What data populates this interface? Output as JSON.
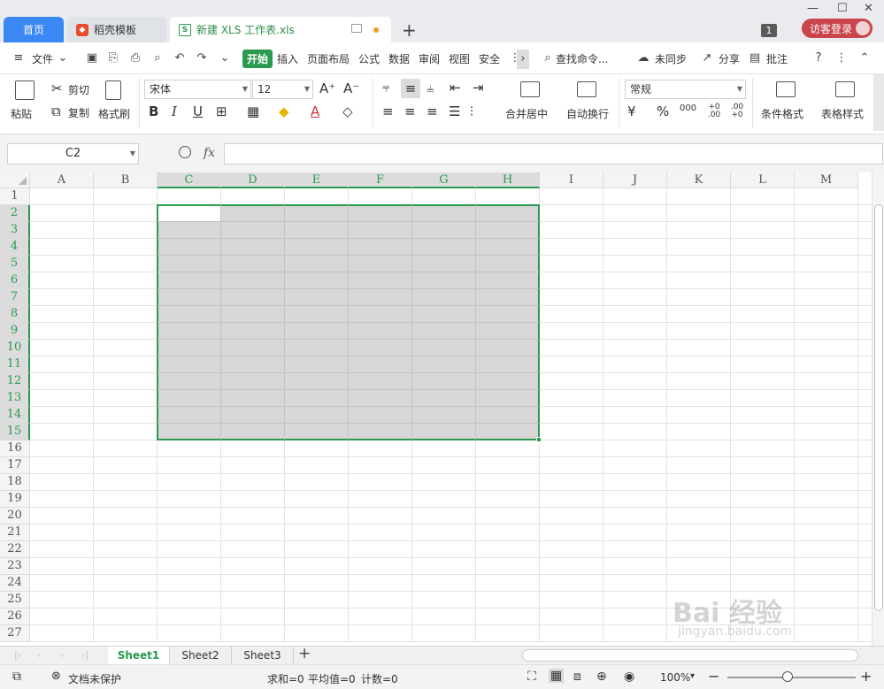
{
  "tabs": {
    "home": "首页",
    "template": "稻壳模板",
    "file": "新建 XLS 工作表.xls",
    "new_tab": "+"
  },
  "window": {
    "badge": "1",
    "login": "访客登录"
  },
  "menu": {
    "file": "文件",
    "items": [
      "开始",
      "插入",
      "页面布局",
      "公式",
      "数据",
      "审阅",
      "视图",
      "安全"
    ],
    "search": "查找命令...",
    "sync": "未同步",
    "share": "分享",
    "comment": "批注"
  },
  "ribbon": {
    "paste": "粘贴",
    "cut": "剪切",
    "copy": "复制",
    "format_painter": "格式刷",
    "font_name": "宋体",
    "font_size": "12",
    "merge_center": "合并居中",
    "wrap_text": "自动换行",
    "number_format": "常规",
    "percent": "%",
    "thousands": "000",
    "inc_decimal": "+0 .00",
    "dec_decimal": ".00 +0",
    "cond_format": "条件格式",
    "table_style": "表格样式"
  },
  "formula_bar": {
    "name_box": "C2",
    "fx": "fx",
    "value": ""
  },
  "grid": {
    "columns": [
      "A",
      "B",
      "C",
      "D",
      "E",
      "F",
      "G",
      "H",
      "I",
      "J",
      "K",
      "L",
      "M"
    ],
    "rows": [
      "1",
      "2",
      "3",
      "4",
      "5",
      "6",
      "7",
      "8",
      "9",
      "10",
      "11",
      "12",
      "13",
      "14",
      "15",
      "16",
      "17",
      "18",
      "19",
      "20",
      "21",
      "22",
      "23",
      "24",
      "25",
      "26",
      "27"
    ],
    "selected_range": "C2:H15",
    "active_cell": "C2"
  },
  "sheets": {
    "names": [
      "Sheet1",
      "Sheet2",
      "Sheet3"
    ],
    "active": "Sheet1"
  },
  "status": {
    "protection": "文档未保护",
    "sum": "求和=0",
    "average": "平均值=0",
    "count": "计数=0",
    "zoom": "100%"
  },
  "watermark": {
    "line1": "Bai 经验",
    "line2": "jingyan.baidu.com"
  }
}
